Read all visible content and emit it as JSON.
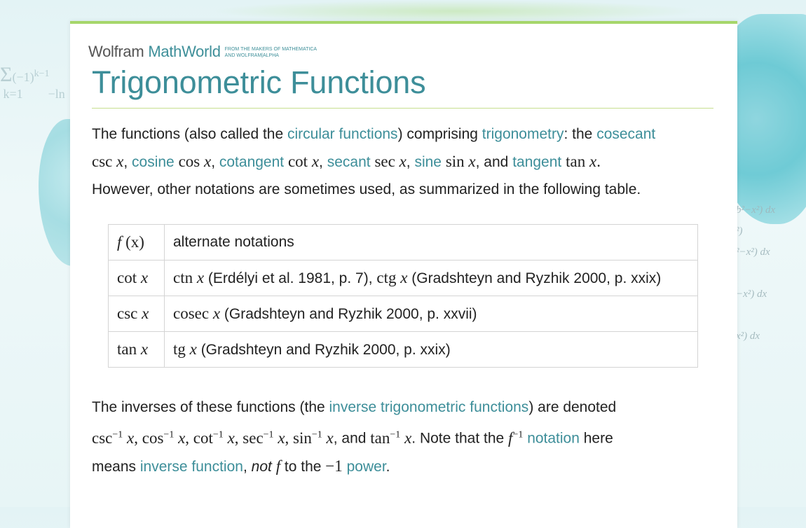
{
  "logo": {
    "wolfram": "Wolfram",
    "mathworld": "MathWorld",
    "tagline_1": "FROM THE MAKERS OF MATHEMATICA",
    "tagline_2": "AND WOLFRAM|ALPHA"
  },
  "page_title": "Trigonometric Functions",
  "intro": {
    "t1": "The functions (also called the ",
    "link_circular": "circular functions",
    "t2": ") comprising ",
    "link_trigonometry": "trigonometry",
    "t3": ": the ",
    "link_cosecant": "cosecant",
    "math_csc": "csc",
    "link_cosine": "cosine",
    "math_cos": "cos",
    "link_cotangent": "cotangent",
    "math_cot": "cot",
    "link_secant": "secant",
    "math_sec": "sec",
    "link_sine": "sine",
    "math_sin": "sin",
    "and": ", and ",
    "link_tangent": "tangent",
    "math_tan": "tan",
    "t4": "However, other notations are sometimes used, as summarized in the following table."
  },
  "table": {
    "header": {
      "col1_f": "f",
      "col1_x": "(x)",
      "col2": "alternate notations"
    },
    "rows": [
      {
        "fn": "cot",
        "alt1": "ctn",
        "ref1": " (Erdélyi et al. 1981, p. 7), ",
        "alt2": "ctg",
        "ref2": " (Gradshteyn and Ryzhik 2000, p. xxix)"
      },
      {
        "fn": "csc",
        "alt1": "cosec",
        "ref1": " (Gradshteyn and Ryzhik 2000, p. xxvii)"
      },
      {
        "fn": "tan",
        "alt1": "tg",
        "ref1": " (Gradshteyn and Ryzhik 2000, p. xxix)"
      }
    ]
  },
  "inverses": {
    "t1": "The inverses of these functions (the ",
    "link_inverse_trig": "inverse trigonometric functions",
    "t2": ") are denoted",
    "t3": ". Note that the ",
    "link_notation": "notation",
    "t4": " here",
    "t5": "means ",
    "link_inverse_function": "inverse function",
    "t6": ", ",
    "not": "not",
    "t7": " to the ",
    "minus_one": "−1",
    "link_power": "power",
    "t8": ".",
    "and": ", and "
  },
  "math": {
    "x": "x",
    "f": "f",
    "inv_exp": "−1"
  },
  "colors": {
    "accent": "#3d8e99",
    "rule": "#a6d66a",
    "text": "#222222"
  }
}
